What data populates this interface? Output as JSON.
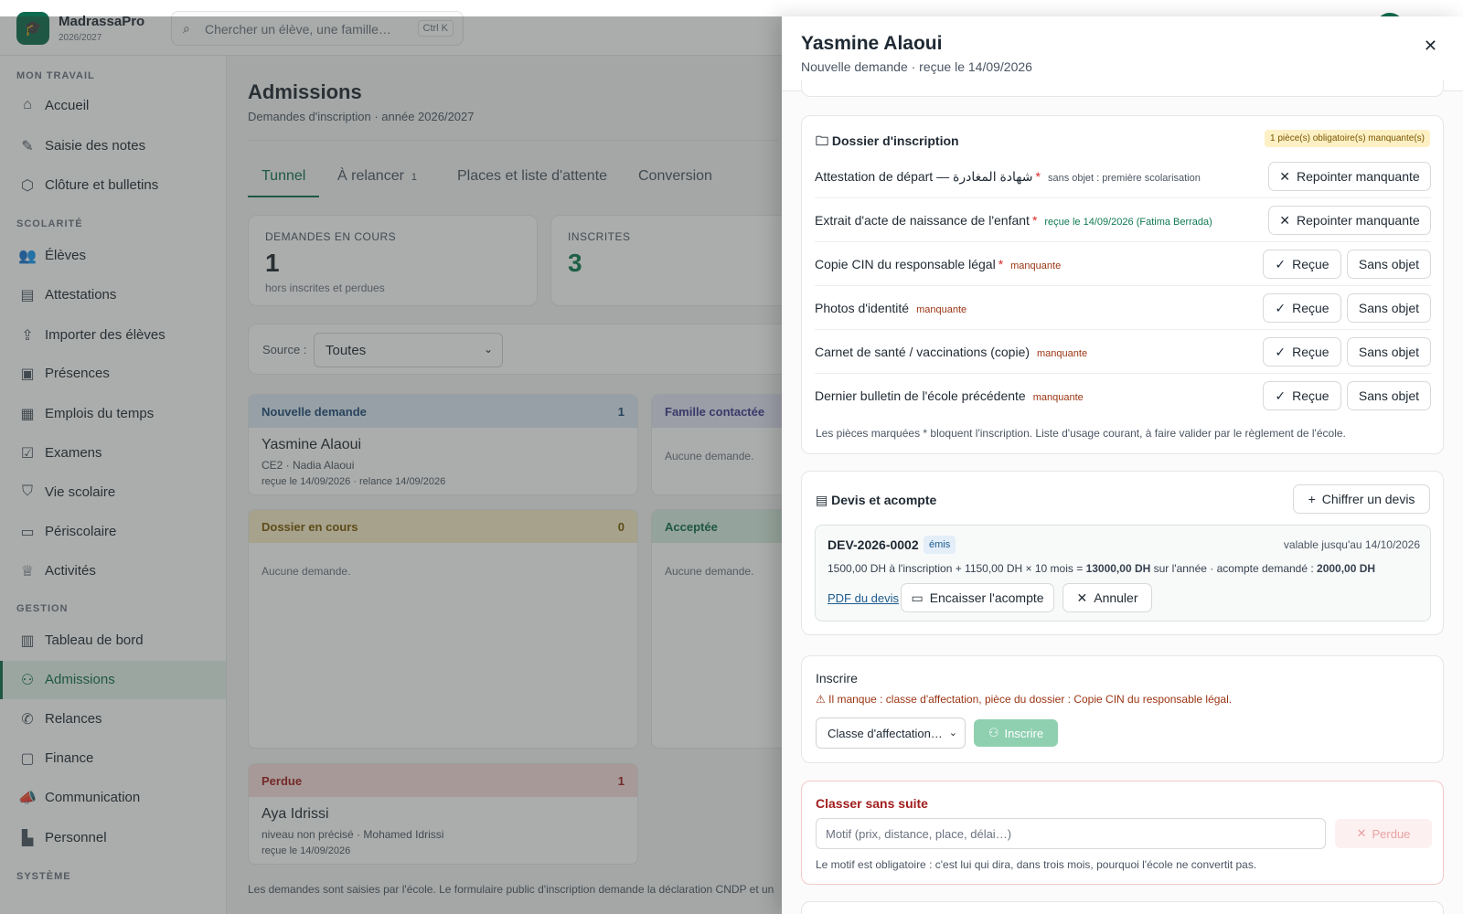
{
  "app": {
    "name": "MadrassaPro",
    "year": "2026/2027"
  },
  "search": {
    "placeholder": "Chercher un élève, une famille…",
    "shortcut": "Ctrl K"
  },
  "sidebar": {
    "sections": [
      "MON TRAVAIL",
      "SCOLARITÉ",
      "GESTION",
      "SYSTÈME"
    ],
    "items": [
      {
        "label": "Accueil",
        "icon": "home-icon"
      },
      {
        "label": "Saisie des notes",
        "icon": "pencil-icon"
      },
      {
        "label": "Clôture et bulletins",
        "icon": "package-icon"
      },
      {
        "label": "Élèves",
        "icon": "users-icon"
      },
      {
        "label": "Attestations",
        "icon": "document-icon"
      },
      {
        "label": "Importer des élèves",
        "icon": "upload-icon"
      },
      {
        "label": "Présences",
        "icon": "clipboard-icon"
      },
      {
        "label": "Emplois du temps",
        "icon": "calendar-icon"
      },
      {
        "label": "Examens",
        "icon": "calendar-check-icon"
      },
      {
        "label": "Vie scolaire",
        "icon": "shield-icon"
      },
      {
        "label": "Périscolaire",
        "icon": "bus-icon"
      },
      {
        "label": "Activités",
        "icon": "trophy-icon"
      },
      {
        "label": "Tableau de bord",
        "icon": "dashboard-icon"
      },
      {
        "label": "Admissions",
        "icon": "user-plus-icon"
      },
      {
        "label": "Relances",
        "icon": "phone-icon"
      },
      {
        "label": "Finance",
        "icon": "wallet-icon"
      },
      {
        "label": "Communication",
        "icon": "megaphone-icon"
      },
      {
        "label": "Personnel",
        "icon": "building-icon"
      }
    ]
  },
  "page": {
    "title": "Admissions",
    "subtitle": "Demandes d'inscription · année 2026/2027",
    "tabs": [
      {
        "label": "Tunnel"
      },
      {
        "label": "À relancer",
        "count": "1"
      },
      {
        "label": "Places et liste d'attente"
      },
      {
        "label": "Conversion"
      }
    ],
    "kpis": [
      {
        "label": "DEMANDES EN COURS",
        "value": "1",
        "sub": "hors inscrites et perdues"
      },
      {
        "label": "INSCRITES",
        "value": "3"
      }
    ],
    "filter": {
      "label": "Source :",
      "value": "Toutes"
    },
    "columns": [
      {
        "name": "Nouvelle demande",
        "count": "1",
        "card": {
          "name": "Yasmine Alaoui",
          "meta1": "CE2 · Nadia Alaoui",
          "meta2": "reçue le 14/09/2026 · relance 14/09/2026"
        }
      },
      {
        "name": "Famille contactée",
        "empty": "Aucune demande."
      },
      {
        "name": "Dossier en cours",
        "count": "0",
        "empty": "Aucune demande."
      },
      {
        "name": "Acceptée",
        "empty": "Aucune demande."
      },
      {
        "name": "Perdue",
        "count": "1",
        "card": {
          "name": "Aya Idrissi",
          "meta1": "niveau non précisé · Mohamed Idrissi",
          "meta2": "reçue le 14/09/2026"
        }
      }
    ],
    "footnote": "Les demandes sont saisies par l'école. Le formulaire public d'inscription demande la déclaration CNDP et un"
  },
  "drawer": {
    "title": "Yasmine Alaoui",
    "subtitle": "Nouvelle demande · reçue le 14/09/2026",
    "dossier": {
      "title": "Dossier d'inscription",
      "badge": "1 pièce(s) obligatoire(s) manquante(s)",
      "rows": [
        {
          "name": "Attestation de départ — شهادة المغادرة",
          "required": "*",
          "status": "sans objet : première scolarisation",
          "kind": "na",
          "action": "Repointer manquante"
        },
        {
          "name": "Extrait d'acte de naissance de l'enfant",
          "required": "*",
          "status": "reçue le 14/09/2026 (Fatima Berrada)",
          "kind": "ok",
          "action": "Repointer manquante"
        },
        {
          "name": "Copie CIN du responsable légal",
          "required": "*",
          "status": "manquante",
          "kind": "miss",
          "recv": "Reçue",
          "na": "Sans objet"
        },
        {
          "name": "Photos d'identité",
          "required": "",
          "status": "manquante",
          "kind": "miss",
          "recv": "Reçue",
          "na": "Sans objet"
        },
        {
          "name": "Carnet de santé / vaccinations (copie)",
          "required": "",
          "status": "manquante",
          "kind": "miss",
          "recv": "Reçue",
          "na": "Sans objet"
        },
        {
          "name": "Dernier bulletin de l'école précédente",
          "required": "",
          "status": "manquante",
          "kind": "miss",
          "recv": "Reçue",
          "na": "Sans objet"
        }
      ],
      "note": "Les pièces marquées * bloquent l'inscription. Liste d'usage courant, à faire valider par le règlement de l'école."
    },
    "devis": {
      "title": "Devis et acompte",
      "add": "Chiffrer un devis",
      "ref": "DEV-2026-0002",
      "status": "émis",
      "valid": "valable jusqu'au 14/10/2026",
      "calc1": "1500,00 DH à l'inscription + 1150,00 DH × 10 mois = ",
      "total": "13000,00 DH",
      "calc2": " sur l'année · acompte demandé : ",
      "deposit": "2000,00 DH",
      "pdf": "PDF du devis",
      "pay": "Encaisser l'acompte",
      "cancel": "Annuler"
    },
    "inscrire": {
      "title": "Inscrire",
      "warning": "Il manque : classe d'affectation, pièce du dossier : Copie CIN du responsable légal.",
      "select": "Classe d'affectation…",
      "button": "Inscrire"
    },
    "classer": {
      "title": "Classer sans suite",
      "placeholder": "Motif (prix, distance, place, délai…)",
      "button": "Perdue",
      "note": "Le motif est obligatoire : c'est lui qui dira, dans trois mois, pourquoi l'école ne convertit pas."
    }
  }
}
